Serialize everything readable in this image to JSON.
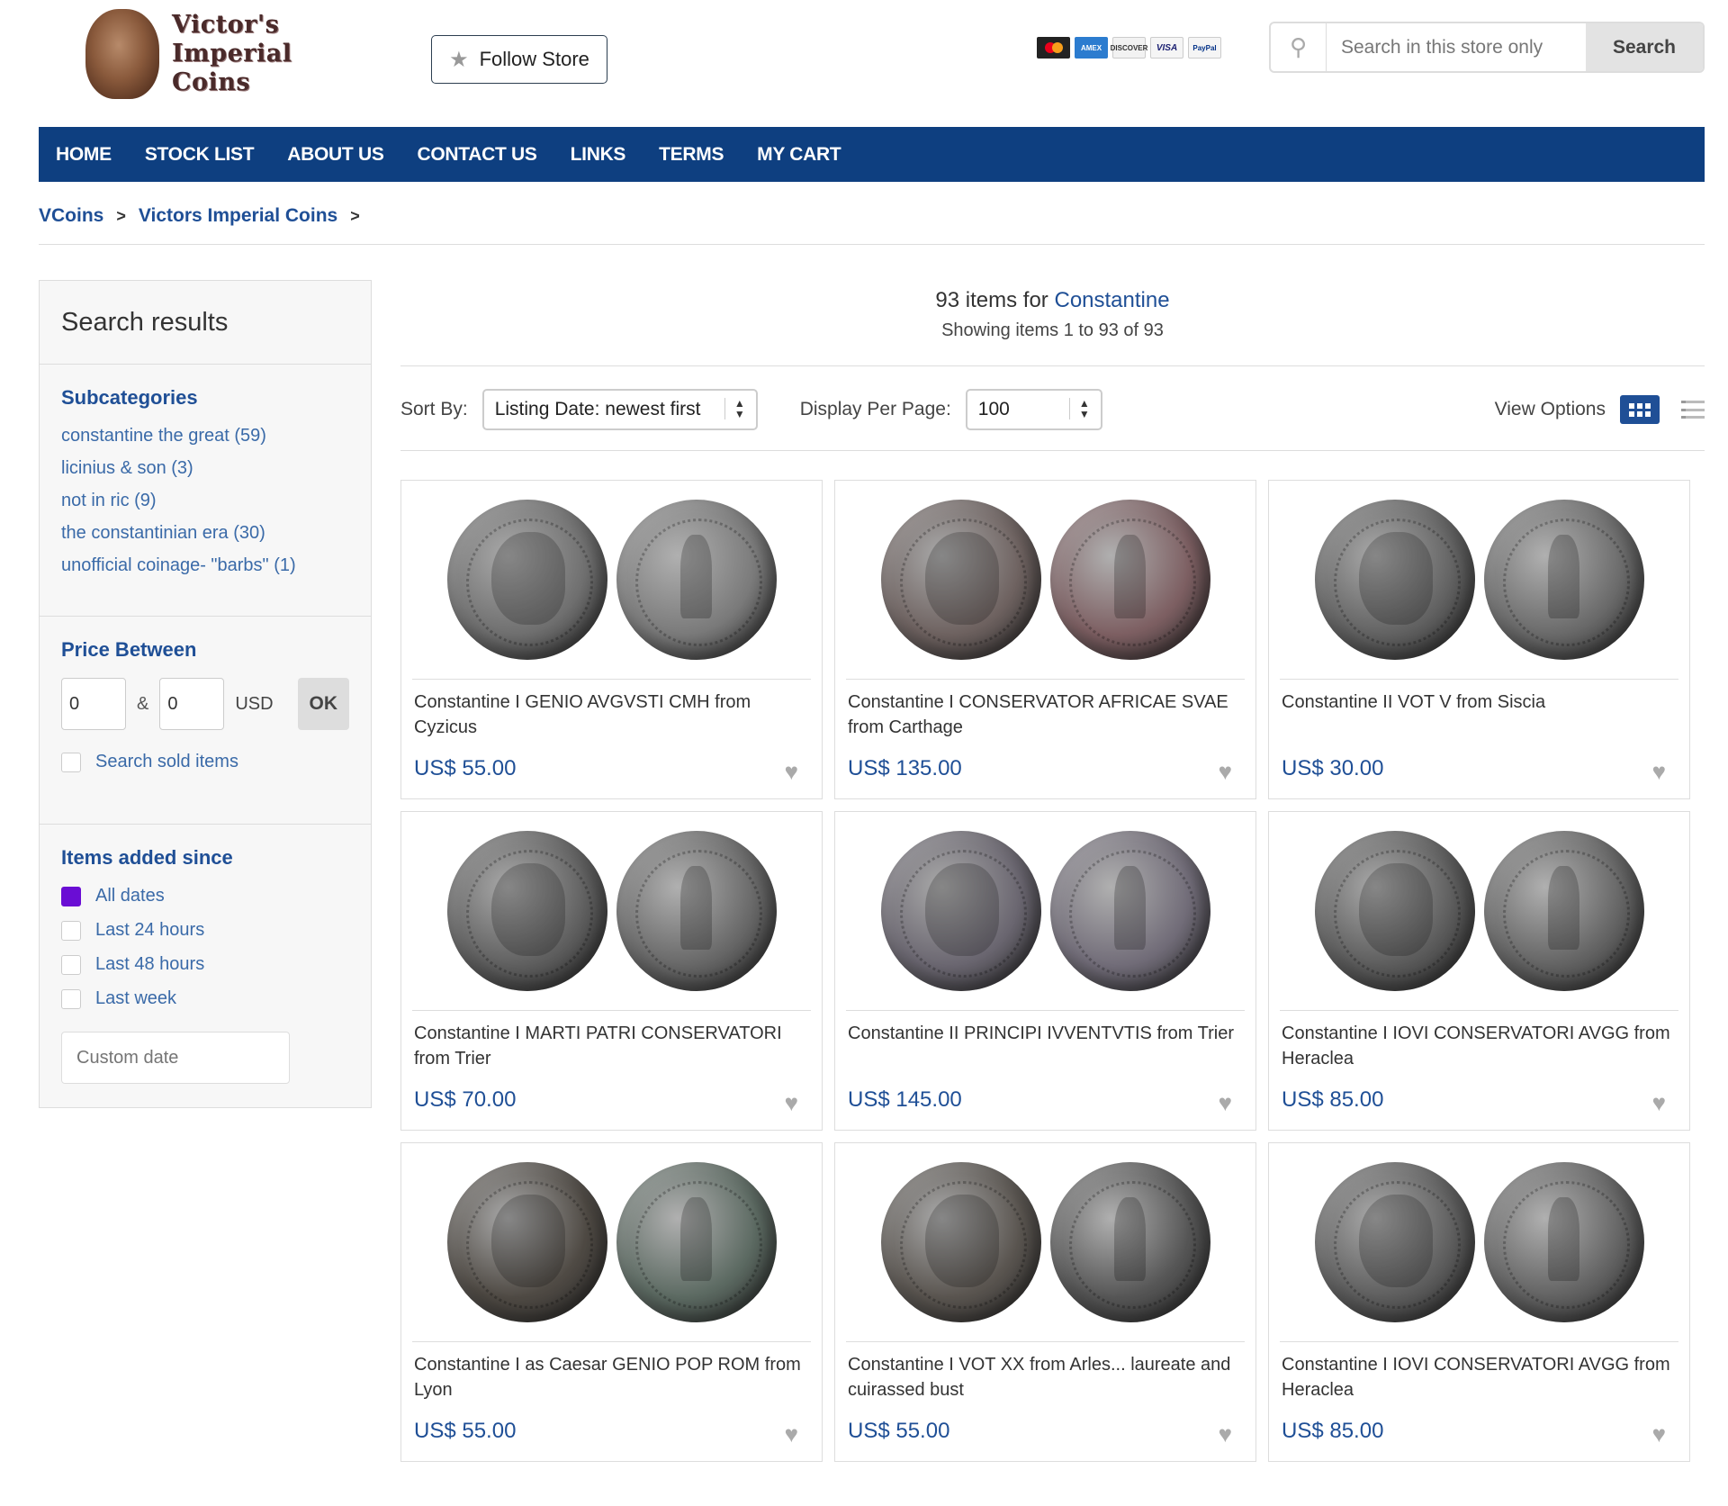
{
  "header": {
    "logo_lines": [
      "Victor's",
      "Imperial",
      "Coins"
    ],
    "follow_label": "Follow Store",
    "payment_icons": [
      "MasterCard",
      "AMEX",
      "DISCOVER",
      "VISA",
      "PayPal"
    ],
    "search_placeholder": "Search in this store only",
    "search_button": "Search"
  },
  "nav": [
    "HOME",
    "STOCK LIST",
    "ABOUT US",
    "CONTACT US",
    "LINKS",
    "TERMS",
    "MY CART"
  ],
  "breadcrumb": [
    "VCoins",
    "Victors Imperial Coins"
  ],
  "sidebar": {
    "title": "Search results",
    "subcategories_heading": "Subcategories",
    "subcategories": [
      "constantine the great (59)",
      "licinius & son (3)",
      "not in ric (9)",
      "the constantinian era (30)",
      "unofficial coinage- \"barbs\" (1)"
    ],
    "price_heading": "Price Between",
    "price_min": "0",
    "price_max": "0",
    "price_amp": "&",
    "currency": "USD",
    "ok_label": "OK",
    "sold_label": "Search sold items",
    "added_heading": "Items added since",
    "date_options": [
      "All dates",
      "Last 24 hours",
      "Last 48 hours",
      "Last week"
    ],
    "selected_date": "All dates",
    "custom_date_placeholder": "Custom date"
  },
  "results": {
    "count_text": "93 items for",
    "query": "Constantine",
    "showing": "Showing items 1 to 93 of 93",
    "sort_label": "Sort By:",
    "sort_value": "Listing Date: newest first",
    "per_page_label": "Display Per Page:",
    "per_page_value": "100",
    "view_options_label": "View Options"
  },
  "products": [
    {
      "title": "Constantine I GENIO AVGVSTI CMH from Cyzicus",
      "price": "US$ 55.00",
      "obv": "#6f6f6f",
      "rev": "#7a7a7a"
    },
    {
      "title": "Constantine I CONSERVATOR AFRICAE SVAE from Carthage",
      "price": "US$ 135.00",
      "obv": "#6e6260",
      "rev": "#7d5f62"
    },
    {
      "title": "Constantine II VOT V from Siscia",
      "price": "US$ 30.00",
      "obv": "#626262",
      "rev": "#6a6a6a"
    },
    {
      "title": "Constantine I MARTI PATRI CONSERVATORI from Trier",
      "price": "US$ 70.00",
      "obv": "#5f5f5f",
      "rev": "#676767"
    },
    {
      "title": "Constantine II PRINCIPI IVVENTVTIS from Trier",
      "price": "US$ 145.00",
      "obv": "#6a6670",
      "rev": "#716c78"
    },
    {
      "title": "Constantine I IOVI CONSERVATORI AVGG from Heraclea",
      "price": "US$ 85.00",
      "obv": "#5c5c5c",
      "rev": "#636363"
    },
    {
      "title": "Constantine I as Caesar GENIO POP ROM from Lyon",
      "price": "US$ 55.00",
      "obv": "#4f4a44",
      "rev": "#5c6a62"
    },
    {
      "title": "Constantine I VOT XX from Arles... laureate and cuirassed bust",
      "price": "US$ 55.00",
      "obv": "#5a5550",
      "rev": "#565656"
    },
    {
      "title": "Constantine I IOVI CONSERVATORI AVGG from Heraclea",
      "price": "US$ 85.00",
      "obv": "#5e5e5e",
      "rev": "#626262"
    }
  ]
}
